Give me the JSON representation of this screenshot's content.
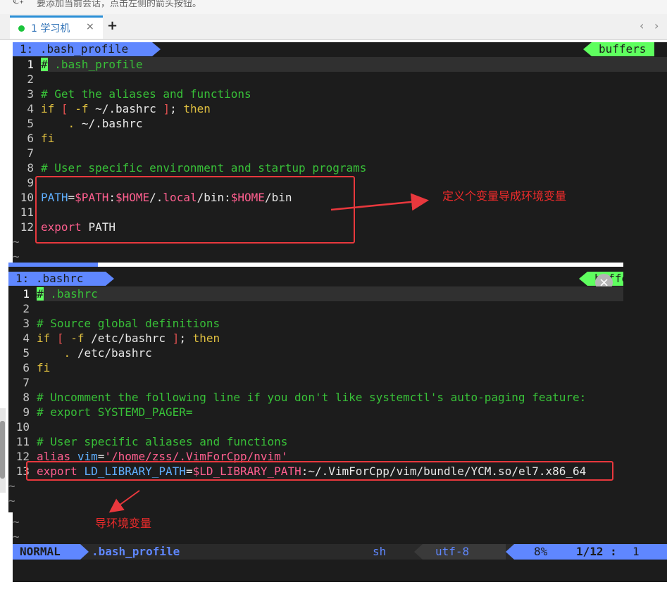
{
  "hint": {
    "icon": "ℂ₊",
    "text": "要添加当前会话，点击左侧的箭头按钮。"
  },
  "tabs": {
    "active_label": "1 学习机",
    "close": "×",
    "add": "+",
    "prev": "‹",
    "next": "›"
  },
  "term1": {
    "filename_tab": "1: .bash_profile",
    "buffers_label": "buffers",
    "lines": [
      {
        "n": "1",
        "text": "# .bash_profile"
      },
      {
        "n": "2",
        "text": ""
      },
      {
        "n": "3",
        "text": "# Get the aliases and functions"
      },
      {
        "n": "4",
        "text": "if [ -f ~/.bashrc ]; then"
      },
      {
        "n": "5",
        "text": "    . ~/.bashrc"
      },
      {
        "n": "6",
        "text": "fi"
      },
      {
        "n": "7",
        "text": ""
      },
      {
        "n": "8",
        "text": "# User specific environment and startup programs"
      },
      {
        "n": "9",
        "text": ""
      },
      {
        "n": "10",
        "text": "PATH=$PATH:$HOME/.local/bin:$HOME/bin"
      },
      {
        "n": "11",
        "text": ""
      },
      {
        "n": "12",
        "text": "export PATH"
      }
    ],
    "tilde": "~"
  },
  "term2": {
    "filename_tab": "1: .bashrc",
    "buffers_label": "buffers",
    "close": "×",
    "lines": [
      {
        "n": "1",
        "text": "# .bashrc"
      },
      {
        "n": "2",
        "text": ""
      },
      {
        "n": "3",
        "text": "# Source global definitions"
      },
      {
        "n": "4",
        "text": "if [ -f /etc/bashrc ]; then"
      },
      {
        "n": "5",
        "text": "    . /etc/bashrc"
      },
      {
        "n": "6",
        "text": "fi"
      },
      {
        "n": "7",
        "text": ""
      },
      {
        "n": "8",
        "text": "# Uncomment the following line if you don't like systemctl's auto-paging feature:"
      },
      {
        "n": "9",
        "text": "# export SYSTEMD_PAGER="
      },
      {
        "n": "10",
        "text": ""
      },
      {
        "n": "11",
        "text": "# User specific aliases and functions"
      },
      {
        "n": "12",
        "text": "alias vim='/home/zss/.VimForCpp/nvim'"
      },
      {
        "n": "13",
        "text": "export LD_LIBRARY_PATH=$LD_LIBRARY_PATH:~/.VimForCpp/vim/bundle/YCM.so/el7.x86_64"
      }
    ]
  },
  "statusline": {
    "mode": "NORMAL",
    "file": ".bash_profile",
    "filetype": "sh",
    "encoding": "utf-8",
    "percent": "8%",
    "position": "1/12 :",
    "column": "1"
  },
  "annotations": {
    "note1": "定义个变量导成环境变量",
    "note2": "导环境变量",
    "color": "#e8383d"
  }
}
